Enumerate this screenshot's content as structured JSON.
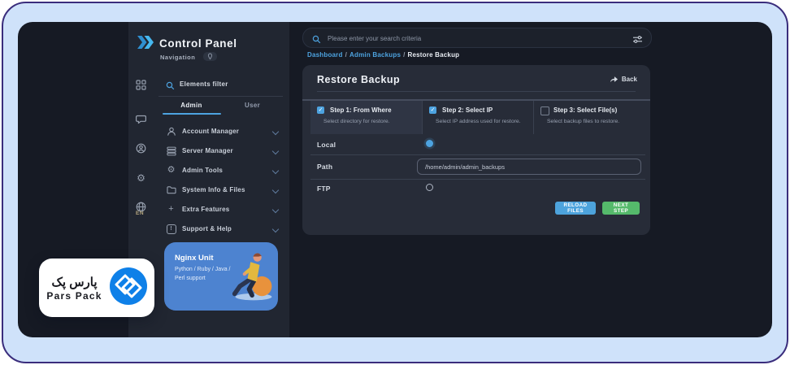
{
  "app": {
    "title": "Control Panel",
    "subtitle": "Navigation"
  },
  "rail": {
    "language": "EN"
  },
  "sidebar": {
    "filter_label": "Elements filter",
    "tabs": {
      "admin": "Admin",
      "user": "User"
    },
    "menu": [
      {
        "label": "Account Manager"
      },
      {
        "label": "Server Manager"
      },
      {
        "label": "Admin Tools"
      },
      {
        "label": "System Info & Files"
      },
      {
        "label": "Extra Features"
      },
      {
        "label": "Support & Help"
      }
    ],
    "promo": {
      "title": "Nginx Unit",
      "subtitle": "Python / Ruby / Java / Perl support"
    }
  },
  "topbar": {
    "search_placeholder": "Please enter your search criteria"
  },
  "breadcrumb": {
    "items": [
      "Dashboard",
      "Admin Backups",
      "Restore Backup"
    ],
    "separator": "/"
  },
  "page": {
    "title": "Restore Backup",
    "back_label": "Back",
    "steps": [
      {
        "title": "Step 1: From Where",
        "subtitle": "Select directory for restore.",
        "checked": true,
        "active": true
      },
      {
        "title": "Step 2: Select IP",
        "subtitle": "Select IP address used for restore.",
        "checked": true,
        "active": false
      },
      {
        "title": "Step 3: Select File(s)",
        "subtitle": "Select backup files to restore.",
        "checked": false,
        "active": false
      }
    ],
    "form": {
      "local_label": "Local",
      "local_selected": true,
      "path_label": "Path",
      "path_value": "/home/admin/admin_backups",
      "ftp_label": "FTP",
      "ftp_selected": false
    },
    "actions": {
      "reload": "RELOAD FILES",
      "next": "NEXT STEP"
    }
  },
  "badge": {
    "brand_fa": "پارس پک",
    "brand_en": "Pars Pack"
  },
  "icons": {
    "gear": "⚙",
    "plus": "+",
    "check": "✓",
    "help": "!"
  },
  "colors": {
    "accent": "#4da3e0",
    "success": "#55ba6b",
    "promo_blue": "#4d83d0",
    "badge_blue": "#0e80e8",
    "frame_fill": "#cfe2fa",
    "frame_border": "#3a2d7c",
    "panel_bg": "#161a24",
    "card_bg": "#272c38"
  }
}
